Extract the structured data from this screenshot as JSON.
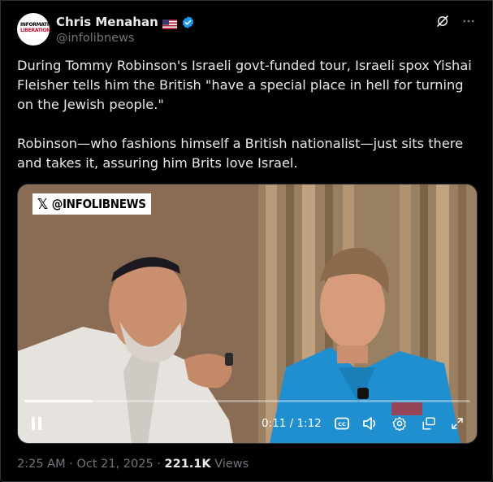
{
  "post": {
    "author_name": "Chris Menahan",
    "handle": "@infolibnews",
    "avatar_line1": "INFORMATION",
    "avatar_line2": "LIBERATION",
    "text": "During Tommy Robinson's Israeli govt-funded tour, Israeli spox Yishai Fleisher tells him the British \"have a special place in hell for turning on the Jewish people.\"\n\nRobinson—who fashions himself a British nationalist—just sits there and takes it, assuring him Brits love Israel.",
    "timestamp": "2:25 AM",
    "separator": "·",
    "date": "Oct 21, 2025",
    "views_count": "221.1K",
    "views_label": "Views"
  },
  "video": {
    "watermark_text": "@INFOLIBNEWS",
    "time_display": "0:11 / 1:12",
    "progress": 0.153
  },
  "icons": {
    "flag": "us-flag-icon",
    "verified": "verified-badge-icon",
    "grok": "grok-icon",
    "more": "more-icon",
    "pause": "pause-icon",
    "captions": "captions-icon",
    "volume": "volume-icon",
    "settings": "settings-icon",
    "popout": "popout-icon",
    "fullscreen": "fullscreen-icon"
  },
  "colors": {
    "verified": "#1d9bf0",
    "secondary_text": "#71767b",
    "background": "#000000"
  }
}
